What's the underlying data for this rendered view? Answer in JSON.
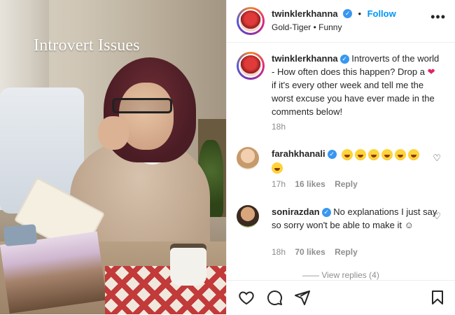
{
  "media": {
    "caption": "Introvert Issues"
  },
  "post": {
    "author": "twinklerkhanna",
    "follow_label": "Follow",
    "subtitle": "Gold-Tiger • Funny",
    "more_label": "•••",
    "caption_text_1": "Introverts of the world - How often does this happen? Drop a",
    "caption_text_2": "if it's every other week and tell me the worst excuse you have ever made in the comments below!",
    "caption_time": "18h"
  },
  "comments": [
    {
      "author": "farahkhanali",
      "emoji_count": 7,
      "time": "17h",
      "likes": "16 likes",
      "reply": "Reply"
    },
    {
      "author": "sonirazdan",
      "text": "No explanations I just say so sorry won't be able to make it ☺",
      "time": "18h",
      "likes": "70 likes",
      "reply": "Reply"
    }
  ],
  "view_replies": "—— View replies (4)",
  "colors": {
    "accent": "#0095f6",
    "verified": "#3897f0",
    "heart": "#e0245e",
    "muted": "#8e8e8e"
  },
  "icons": [
    "heart-icon",
    "comment-icon",
    "share-icon",
    "bookmark-icon",
    "verified-icon",
    "more-icon"
  ]
}
